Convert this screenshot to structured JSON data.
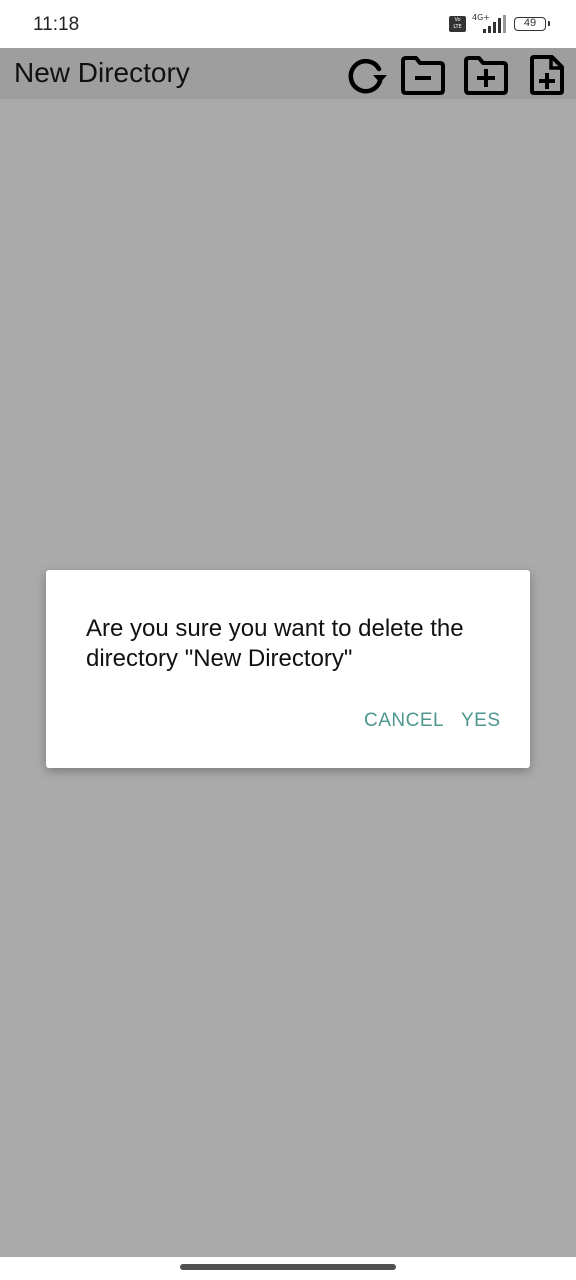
{
  "status_bar": {
    "time": "11:18",
    "volte_label": "Vo\nLTE",
    "network_label": "4G+",
    "battery_level": "49"
  },
  "app_bar": {
    "title": "New Directory",
    "actions": [
      {
        "name": "refresh",
        "icon": "refresh-icon"
      },
      {
        "name": "delete-directory",
        "icon": "folder-minus-icon"
      },
      {
        "name": "new-directory",
        "icon": "folder-plus-icon"
      },
      {
        "name": "new-file",
        "icon": "file-plus-icon"
      }
    ]
  },
  "dialog": {
    "message": "Are you sure you want to delete the directory \"New Directory\"",
    "cancel_label": "CANCEL",
    "confirm_label": "YES"
  },
  "colors": {
    "scrim": "#aaaaaa",
    "app_bar": "#9e9e9e",
    "dialog_button": "#4d978f"
  }
}
